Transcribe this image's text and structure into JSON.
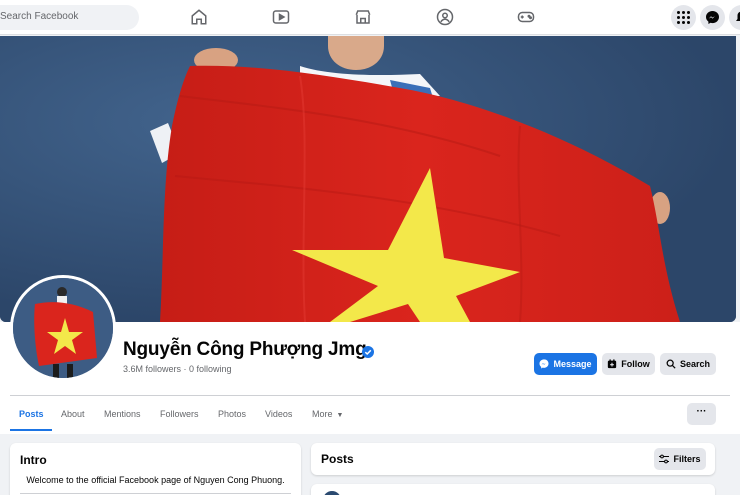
{
  "topbar": {
    "search_placeholder": "Search Facebook",
    "nav_icons": [
      "home-icon",
      "watch-icon",
      "marketplace-icon",
      "groups-icon",
      "gaming-icon"
    ],
    "right_icons": [
      "menu-grid-icon",
      "messenger-icon",
      "notifications-icon"
    ]
  },
  "profile": {
    "name": "Nguyễn Công Phượng Jmg",
    "followers": "3.6M followers",
    "separator": " · ",
    "following": "0 following",
    "verified_icon": "verified-badge-icon"
  },
  "actions": {
    "message": "Message",
    "follow": "Follow",
    "search": "Search"
  },
  "tabs": [
    {
      "label": "Posts",
      "active": true
    },
    {
      "label": "About"
    },
    {
      "label": "Mentions"
    },
    {
      "label": "Followers"
    },
    {
      "label": "Photos"
    },
    {
      "label": "Videos"
    },
    {
      "label": "More"
    }
  ],
  "more_menu": "···",
  "intro": {
    "title": "Intro",
    "text": "Welcome to the official Facebook page of Nguyen Cong Phuong."
  },
  "posts": {
    "title": "Posts",
    "filters": "Filters"
  },
  "colors": {
    "accent": "#1b74e4",
    "flag_red": "#da251d",
    "flag_star": "#ffff00"
  }
}
